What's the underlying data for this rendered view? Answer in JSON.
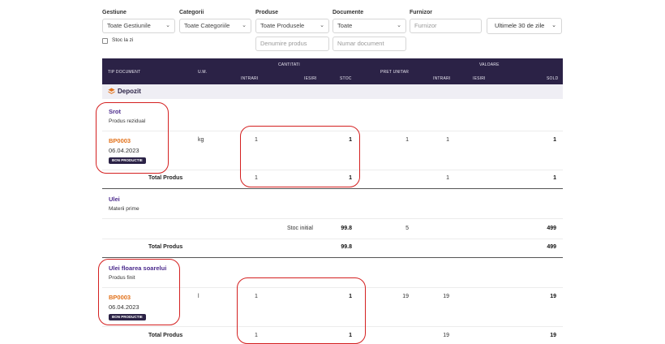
{
  "filters": {
    "gestiune": {
      "label": "Gestiune",
      "value": "Toate Gestiunile"
    },
    "categorii": {
      "label": "Categorii",
      "value": "Toate Categoriile"
    },
    "produse": {
      "label": "Produse",
      "value": "Toate Produsele",
      "search_placeholder": "Denumire produs"
    },
    "documente": {
      "label": "Documente",
      "value": "Toate",
      "search_placeholder": "Numar document"
    },
    "furnizor": {
      "label": "Furnizor",
      "placeholder": "Furnizor"
    },
    "period": "Ultimele 30 de zile",
    "stoc_checkbox": {
      "label": "Stoc la zi",
      "checked": false
    }
  },
  "table": {
    "headers": {
      "tip_document": "TIP DOCUMENT",
      "um": "U.M.",
      "cantitati": "CANTITATI",
      "intrari": "INTRARI",
      "iesiri": "IESIRI",
      "stoc": "STOC",
      "pret_unitar": "PRET UNITAR",
      "valoare": "VALOARE",
      "v_intrari": "INTRARI",
      "v_iesiri": "IESIRI",
      "sold": "SOLD"
    },
    "group": "Depozit",
    "products": [
      {
        "name": "Srot",
        "category": "Produs rezidual",
        "doc": {
          "number": "BP0003",
          "date": "06.04.2023",
          "badge": "BON PRODUCTIE",
          "um": "kg",
          "intrari": "1",
          "stoc": "1",
          "pret_unitar": "1",
          "v_intrari": "1",
          "sold": "1"
        },
        "total": {
          "label": "Total Produs",
          "intrari": "1",
          "stoc": "1",
          "v_intrari": "1",
          "sold": "1"
        }
      },
      {
        "name": "Ulei",
        "category": "Materii prime",
        "initial": {
          "label": "Stoc initial",
          "stoc": "99.8",
          "pret_unitar": "5",
          "sold": "499"
        },
        "total": {
          "label": "Total Produs",
          "stoc": "99.8",
          "sold": "499"
        }
      },
      {
        "name": "Ulei floarea soarelui",
        "category": "Produs finit",
        "doc": {
          "number": "BP0003",
          "date": "06.04.2023",
          "badge": "BON PRODUCTIE",
          "um": "l",
          "intrari": "1",
          "stoc": "1",
          "pret_unitar": "19",
          "v_intrari": "19",
          "sold": "19"
        },
        "total": {
          "label": "Total Produs",
          "intrari": "1",
          "stoc": "1",
          "v_intrari": "19",
          "sold": "19"
        }
      }
    ]
  },
  "colors": {
    "header_bg": "#2b2246",
    "accent_orange": "#e2721b",
    "product_purple": "#4b2a8c",
    "annotation_red": "#d42020"
  }
}
